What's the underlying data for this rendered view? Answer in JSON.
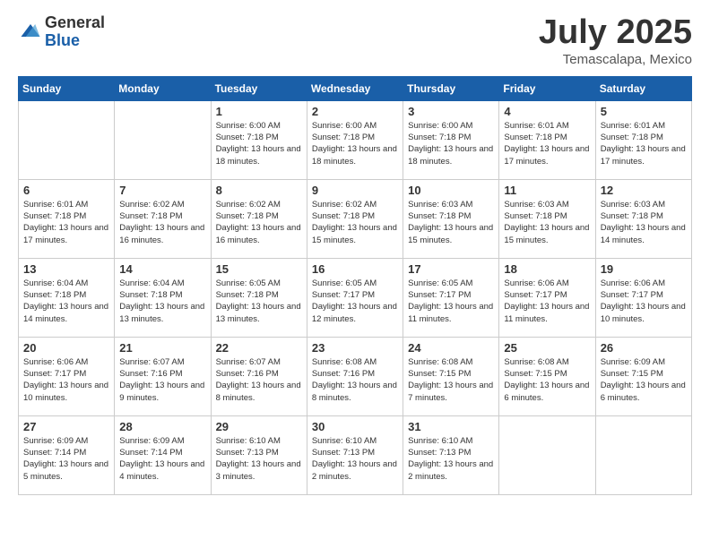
{
  "header": {
    "logo_line1": "General",
    "logo_line2": "Blue",
    "month_title": "July 2025",
    "location": "Temascalapa, Mexico"
  },
  "weekdays": [
    "Sunday",
    "Monday",
    "Tuesday",
    "Wednesday",
    "Thursday",
    "Friday",
    "Saturday"
  ],
  "weeks": [
    [
      {
        "day": "",
        "info": ""
      },
      {
        "day": "",
        "info": ""
      },
      {
        "day": "1",
        "info": "Sunrise: 6:00 AM\nSunset: 7:18 PM\nDaylight: 13 hours and 18 minutes."
      },
      {
        "day": "2",
        "info": "Sunrise: 6:00 AM\nSunset: 7:18 PM\nDaylight: 13 hours and 18 minutes."
      },
      {
        "day": "3",
        "info": "Sunrise: 6:00 AM\nSunset: 7:18 PM\nDaylight: 13 hours and 18 minutes."
      },
      {
        "day": "4",
        "info": "Sunrise: 6:01 AM\nSunset: 7:18 PM\nDaylight: 13 hours and 17 minutes."
      },
      {
        "day": "5",
        "info": "Sunrise: 6:01 AM\nSunset: 7:18 PM\nDaylight: 13 hours and 17 minutes."
      }
    ],
    [
      {
        "day": "6",
        "info": "Sunrise: 6:01 AM\nSunset: 7:18 PM\nDaylight: 13 hours and 17 minutes."
      },
      {
        "day": "7",
        "info": "Sunrise: 6:02 AM\nSunset: 7:18 PM\nDaylight: 13 hours and 16 minutes."
      },
      {
        "day": "8",
        "info": "Sunrise: 6:02 AM\nSunset: 7:18 PM\nDaylight: 13 hours and 16 minutes."
      },
      {
        "day": "9",
        "info": "Sunrise: 6:02 AM\nSunset: 7:18 PM\nDaylight: 13 hours and 15 minutes."
      },
      {
        "day": "10",
        "info": "Sunrise: 6:03 AM\nSunset: 7:18 PM\nDaylight: 13 hours and 15 minutes."
      },
      {
        "day": "11",
        "info": "Sunrise: 6:03 AM\nSunset: 7:18 PM\nDaylight: 13 hours and 15 minutes."
      },
      {
        "day": "12",
        "info": "Sunrise: 6:03 AM\nSunset: 7:18 PM\nDaylight: 13 hours and 14 minutes."
      }
    ],
    [
      {
        "day": "13",
        "info": "Sunrise: 6:04 AM\nSunset: 7:18 PM\nDaylight: 13 hours and 14 minutes."
      },
      {
        "day": "14",
        "info": "Sunrise: 6:04 AM\nSunset: 7:18 PM\nDaylight: 13 hours and 13 minutes."
      },
      {
        "day": "15",
        "info": "Sunrise: 6:05 AM\nSunset: 7:18 PM\nDaylight: 13 hours and 13 minutes."
      },
      {
        "day": "16",
        "info": "Sunrise: 6:05 AM\nSunset: 7:17 PM\nDaylight: 13 hours and 12 minutes."
      },
      {
        "day": "17",
        "info": "Sunrise: 6:05 AM\nSunset: 7:17 PM\nDaylight: 13 hours and 11 minutes."
      },
      {
        "day": "18",
        "info": "Sunrise: 6:06 AM\nSunset: 7:17 PM\nDaylight: 13 hours and 11 minutes."
      },
      {
        "day": "19",
        "info": "Sunrise: 6:06 AM\nSunset: 7:17 PM\nDaylight: 13 hours and 10 minutes."
      }
    ],
    [
      {
        "day": "20",
        "info": "Sunrise: 6:06 AM\nSunset: 7:17 PM\nDaylight: 13 hours and 10 minutes."
      },
      {
        "day": "21",
        "info": "Sunrise: 6:07 AM\nSunset: 7:16 PM\nDaylight: 13 hours and 9 minutes."
      },
      {
        "day": "22",
        "info": "Sunrise: 6:07 AM\nSunset: 7:16 PM\nDaylight: 13 hours and 8 minutes."
      },
      {
        "day": "23",
        "info": "Sunrise: 6:08 AM\nSunset: 7:16 PM\nDaylight: 13 hours and 8 minutes."
      },
      {
        "day": "24",
        "info": "Sunrise: 6:08 AM\nSunset: 7:15 PM\nDaylight: 13 hours and 7 minutes."
      },
      {
        "day": "25",
        "info": "Sunrise: 6:08 AM\nSunset: 7:15 PM\nDaylight: 13 hours and 6 minutes."
      },
      {
        "day": "26",
        "info": "Sunrise: 6:09 AM\nSunset: 7:15 PM\nDaylight: 13 hours and 6 minutes."
      }
    ],
    [
      {
        "day": "27",
        "info": "Sunrise: 6:09 AM\nSunset: 7:14 PM\nDaylight: 13 hours and 5 minutes."
      },
      {
        "day": "28",
        "info": "Sunrise: 6:09 AM\nSunset: 7:14 PM\nDaylight: 13 hours and 4 minutes."
      },
      {
        "day": "29",
        "info": "Sunrise: 6:10 AM\nSunset: 7:13 PM\nDaylight: 13 hours and 3 minutes."
      },
      {
        "day": "30",
        "info": "Sunrise: 6:10 AM\nSunset: 7:13 PM\nDaylight: 13 hours and 2 minutes."
      },
      {
        "day": "31",
        "info": "Sunrise: 6:10 AM\nSunset: 7:13 PM\nDaylight: 13 hours and 2 minutes."
      },
      {
        "day": "",
        "info": ""
      },
      {
        "day": "",
        "info": ""
      }
    ]
  ]
}
